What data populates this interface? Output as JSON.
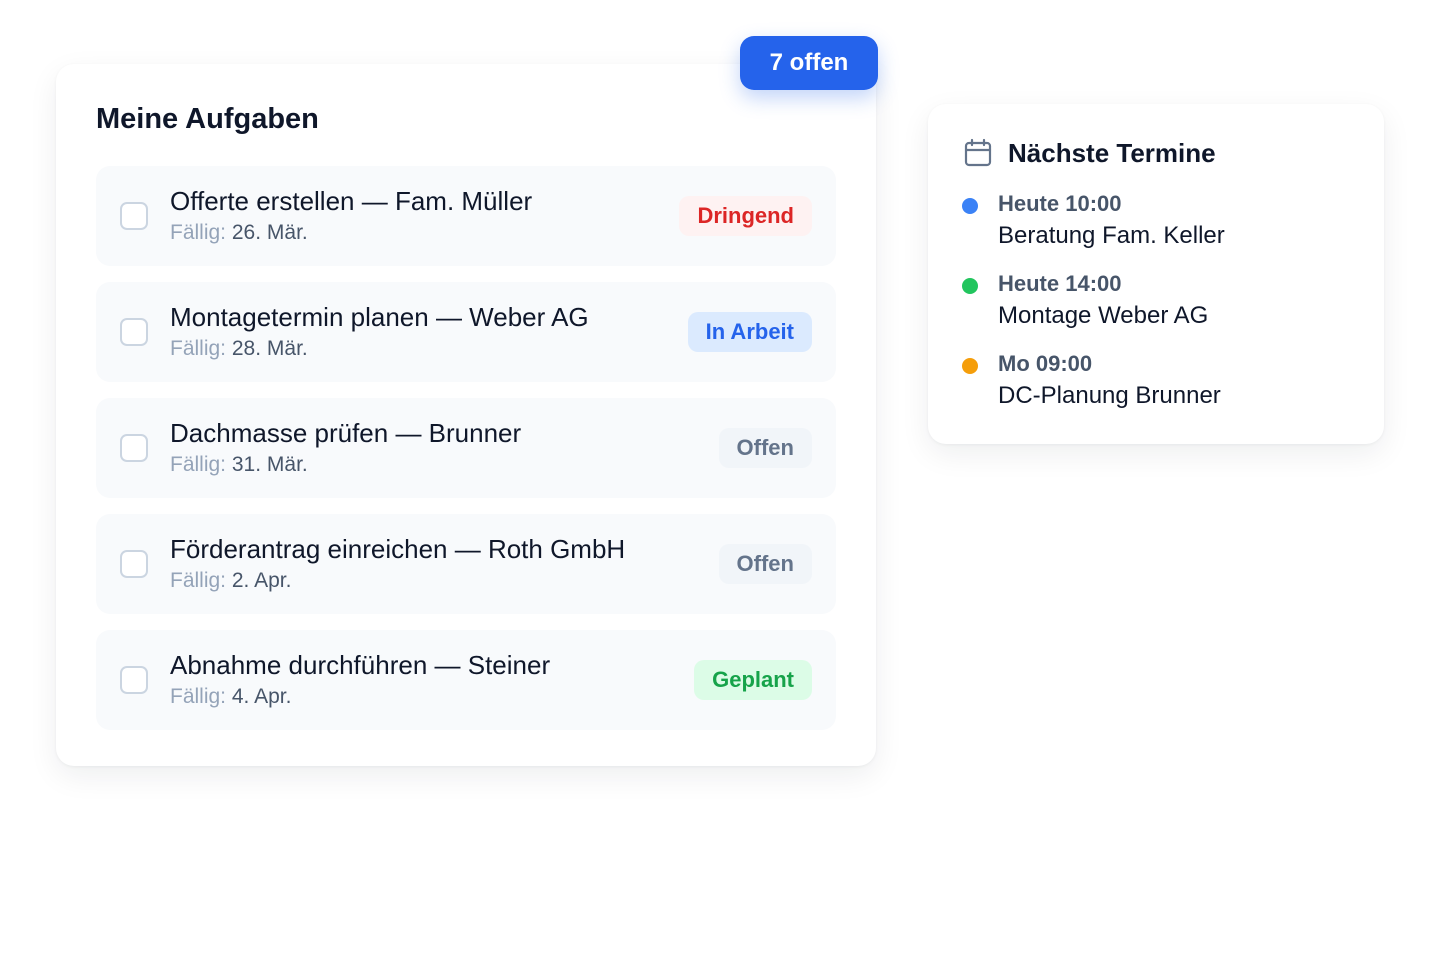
{
  "tasks": {
    "title": "Meine Aufgaben",
    "open_badge": "7 offen",
    "due_label": "Fällig:",
    "items": [
      {
        "name": "Offerte erstellen — Fam. Müller",
        "due": "26. Mär.",
        "status": "Dringend",
        "status_color": "#dc2626"
      },
      {
        "name": "Montagetermin planen — Weber AG",
        "due": "28. Mär.",
        "status": "In Arbeit",
        "status_color": "#2563eb"
      },
      {
        "name": "Dachmasse prüfen — Brunner",
        "due": "31. Mär.",
        "status": "Offen",
        "status_color": "#64748b"
      },
      {
        "name": "Förderantrag einreichen — Roth GmbH",
        "due": "2. Apr.",
        "status": "Offen",
        "status_color": "#64748b"
      },
      {
        "name": "Abnahme durchführen — Steiner",
        "due": "4. Apr.",
        "status": "Geplant",
        "status_color": "#16a34a"
      }
    ]
  },
  "appointments": {
    "title": "Nächste Termine",
    "icon": "calendar-icon",
    "items": [
      {
        "time": "Heute 10:00",
        "name": "Beratung Fam. Keller",
        "dot_color": "#3b82f6"
      },
      {
        "time": "Heute 14:00",
        "name": "Montage Weber AG",
        "dot_color": "#22c55e"
      },
      {
        "time": "Mo 09:00",
        "name": "DC-Planung Brunner",
        "dot_color": "#f59e0b"
      }
    ]
  },
  "colors": {
    "accent": "#2563eb",
    "text": "#0f172a",
    "muted": "#94a3b8"
  }
}
